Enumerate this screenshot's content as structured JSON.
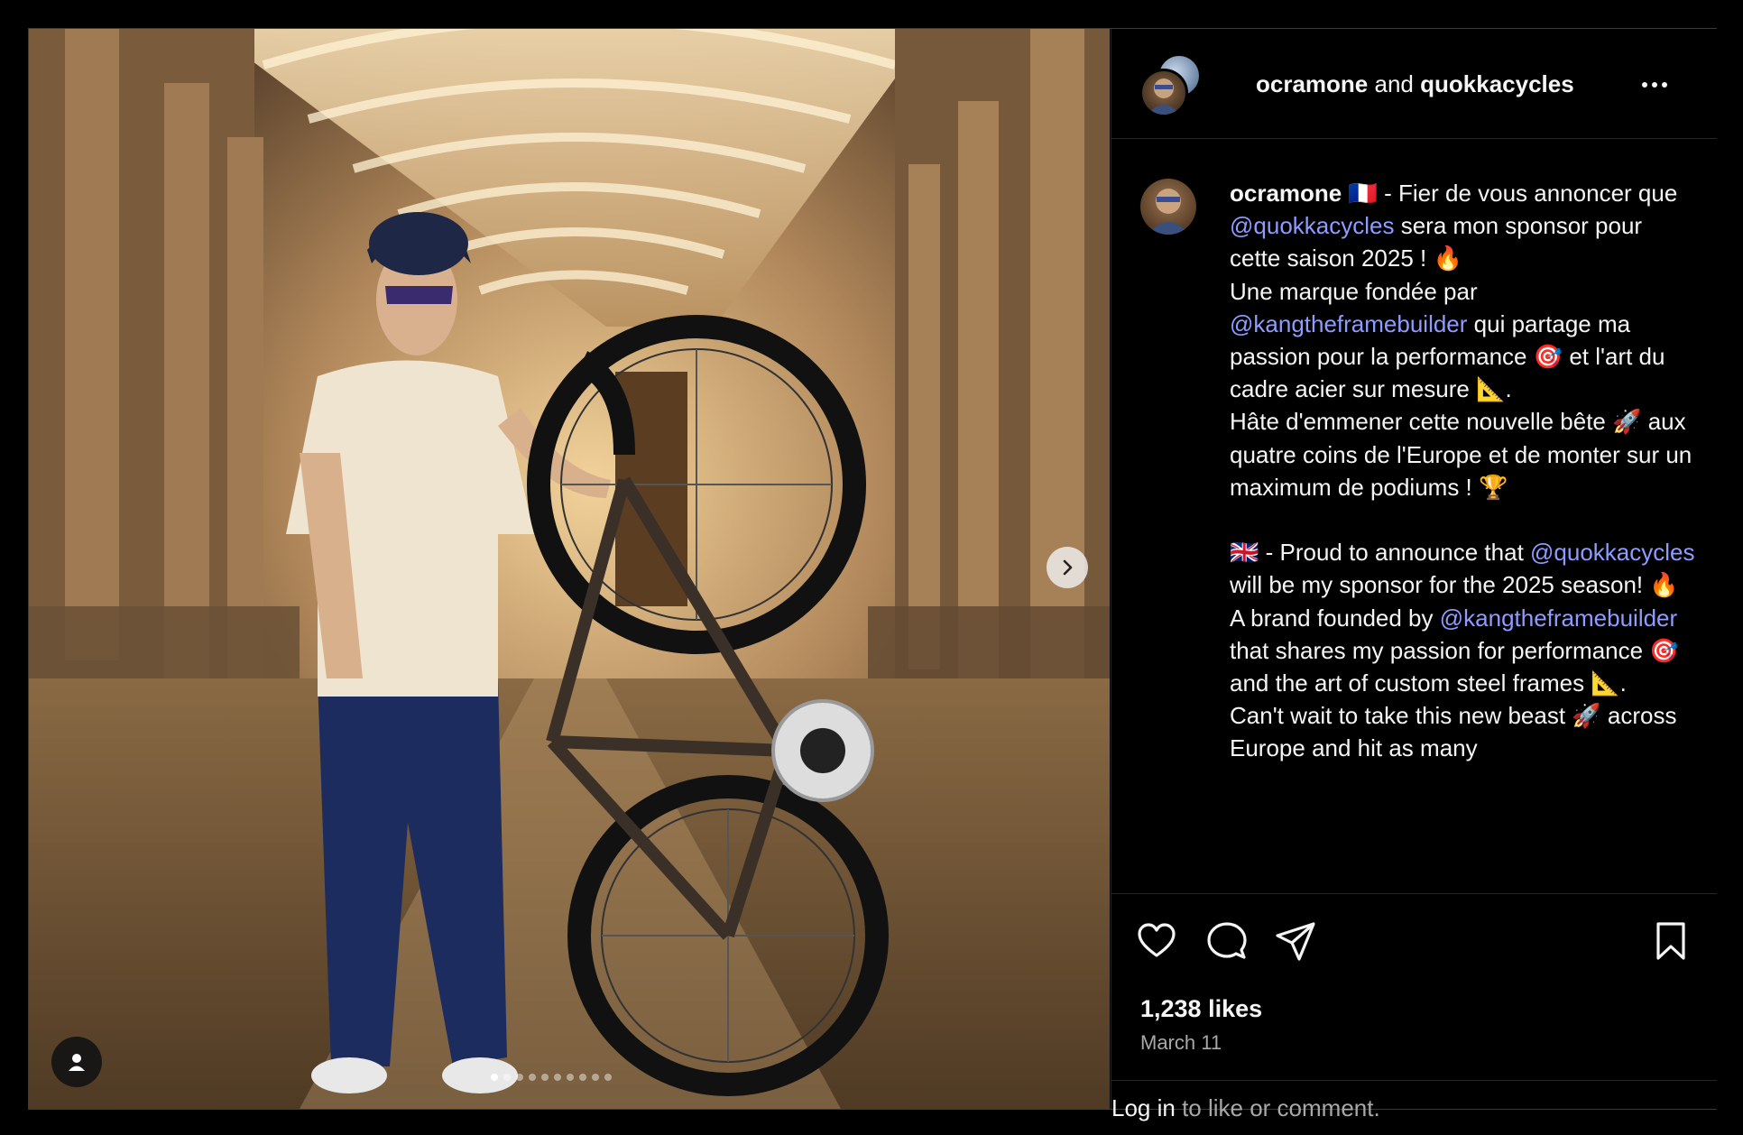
{
  "post": {
    "author": "ocramone",
    "connector": "and",
    "collaborator": "quokkacycles",
    "carousel": {
      "total": 10,
      "active": 0
    }
  },
  "caption": {
    "username": "ocramone",
    "lines": [
      {
        "parts": [
          {
            "t": "🇫🇷 - Fier de vous annoncer que "
          },
          {
            "m": "@quokkacycles"
          },
          {
            "t": " sera mon sponsor pour cette saison 2025 ! 🔥"
          }
        ]
      },
      {
        "parts": [
          {
            "t": "Une marque fondée par "
          },
          {
            "m": "@kangtheframebuilder"
          },
          {
            "t": " qui partage ma passion pour la performance 🎯 et l'art du cadre acier sur mesure 📐."
          }
        ]
      },
      {
        "parts": [
          {
            "t": "Hâte d'emmener cette nouvelle bête 🚀 aux quatre coins de l'Europe et de monter sur un maximum de podiums ! 🏆"
          }
        ]
      },
      {
        "gap": true
      },
      {
        "parts": [
          {
            "t": "🇬🇧 - Proud to announce that "
          },
          {
            "m": "@quokkacycles"
          },
          {
            "t": " will be my sponsor for the 2025 season! 🔥"
          }
        ]
      },
      {
        "parts": [
          {
            "t": "A brand founded by "
          },
          {
            "m": "@kangtheframebuilder"
          },
          {
            "t": " that shares my passion for performance 🎯 and the art of custom steel frames 📐."
          }
        ]
      },
      {
        "parts": [
          {
            "t": "Can't wait to take this new beast 🚀 across Europe and hit as many"
          }
        ]
      }
    ]
  },
  "stats": {
    "likes": "1,238 likes",
    "date": "March 11"
  },
  "login": {
    "link": "Log in",
    "rest": " to like or comment."
  },
  "icons": {
    "like": "heart-icon",
    "comment": "comment-icon",
    "share": "share-icon",
    "save": "bookmark-icon",
    "more": "more-icon",
    "next": "chevron-right-icon",
    "tags": "person-icon"
  },
  "colors": {
    "mention": "#8e9bff",
    "background": "#000000",
    "muted": "#a8a8a8"
  }
}
